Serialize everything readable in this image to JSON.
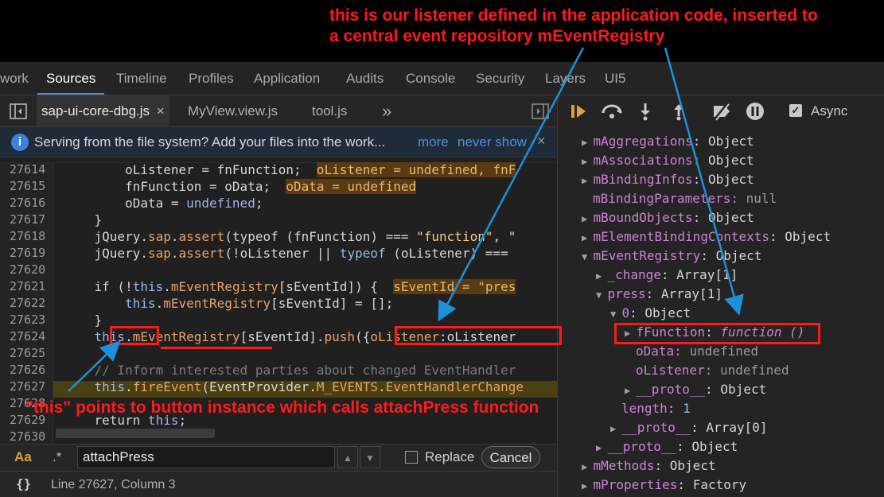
{
  "annotations": {
    "top_line1": "this is our listener defined in the application code, inserted to",
    "top_line2": "a central event repository mEventRegistry",
    "bottom": "\"this\" points to button instance which calls attachPress function"
  },
  "panels": {
    "tabs": [
      "work",
      "Sources",
      "Timeline",
      "Profiles",
      "Application",
      "Audits",
      "Console",
      "Security",
      "Layers",
      "UI5"
    ],
    "active": "Sources"
  },
  "files": {
    "tabs": [
      "sap-ui-core-dbg.js",
      "MyView.view.js",
      "tool.js"
    ],
    "close": "×",
    "more": "»"
  },
  "infobar": {
    "message": "Serving from the file system? Add your files into the work...",
    "more": "more",
    "never": "never show",
    "close": "×"
  },
  "code": {
    "lines": [
      "27614",
      "27615",
      "27616",
      "27617",
      "27618",
      "27619",
      "27620",
      "27621",
      "27622",
      "27623",
      "27624",
      "27625",
      "27626",
      "27627",
      "27628",
      "27629",
      "27630"
    ],
    "l27614": "        oListener = fnFunction;",
    "l27614i": "oListener = undefined, fnF",
    "l27615": "        fnFunction = oData;",
    "l27615i": "oData = undefined",
    "l27616a": "        oData = ",
    "l27616b": "undefined",
    "l27616c": ";",
    "l27617": "    }",
    "l27618a": "    jQuery.",
    "l27618b": "sap",
    "l27618c": ".",
    "l27618d": "assert",
    "l27618e": "(typeof (fnFunction) === ",
    "l27618f": "\"function\"",
    "l27618g": ", \"",
    "l27619a": "    jQuery.",
    "l27619b": "sap",
    "l27619c": ".",
    "l27619d": "assert",
    "l27619e": "(!oListener || ",
    "l27619f": "typeof",
    "l27619g": " (oListener) ===",
    "l27621a": "    if (!",
    "l27621b": "this",
    "l27621c": ".",
    "l27621d": "mEventRegistry",
    "l27621e": "[sEventId]) {",
    "l27621i": "sEventId = \"pres",
    "l27622a": "        ",
    "l27622b": "this",
    "l27622c": ".",
    "l27622d": "mEventRegistry",
    "l27622e": "[sEventId] = [];",
    "l27623": "    }",
    "l27624a": "    ",
    "l27624b": "this",
    "l27624c": ".",
    "l27624d": "mEventRegistry",
    "l27624e": "[sEventId].",
    "l27624f": "push",
    "l27624g": "({",
    "l27624h": "oListener",
    "l27624i": ":oListener",
    "l27626": "    // Inform interested parties about changed EventHandler",
    "l27627a": "    ",
    "l27627b": "this",
    "l27627c": ".",
    "l27627d": "fireEvent",
    "l27627e": "(EventProvider.",
    "l27627f": "M_EVENTS",
    "l27627g": ".",
    "l27627h": "EventHandlerChange",
    "l27629a": "    return ",
    "l27629b": "this",
    "l27629c": ";"
  },
  "search": {
    "case": "Aa",
    "regex": ".*",
    "value": "attachPress",
    "replace": "Replace",
    "cancel": "Cancel"
  },
  "status": {
    "braces": "{}",
    "position": "Line 27627, Column 3"
  },
  "debugger": {
    "async": "Async"
  },
  "scope": {
    "rows": [
      {
        "k": "mAggregations",
        "v": ": Object"
      },
      {
        "k": "mAssociations",
        "v": ": Object"
      },
      {
        "k": "mBindingInfos",
        "v": ": Object"
      },
      {
        "k": "mBindingParameters",
        "v": ": null"
      },
      {
        "k": "mBoundObjects",
        "v": ": Object"
      },
      {
        "k": "mElementBindingContexts",
        "v": ": Object"
      },
      {
        "k": "mEventRegistry",
        "v": ": Object"
      },
      {
        "k": "_change",
        "v": ": Array[1]"
      },
      {
        "k": "press",
        "v": ": Array[1]"
      },
      {
        "k": "0",
        "v": ": Object"
      },
      {
        "k": "fFunction",
        "v": ": "
      },
      {
        "k": "oData",
        "v": ": undefined"
      },
      {
        "k": "oListener",
        "v": ": undefined"
      },
      {
        "k": "__proto__",
        "v": ": Object"
      },
      {
        "k": "length",
        "v": ": 1"
      },
      {
        "k": "__proto__",
        "v": ": Array[0]"
      },
      {
        "k": "__proto__",
        "v": ": Object"
      },
      {
        "k": "mMethods",
        "v": ": Object"
      },
      {
        "k": "mProperties",
        "v": ": Factory"
      }
    ],
    "ffunction_value": "function ()"
  },
  "colors": {
    "accent": "#4a8fe3",
    "annotation": "#ff1a1a",
    "arrow": "#1e90d8",
    "highlight_line": "#4a4010"
  }
}
